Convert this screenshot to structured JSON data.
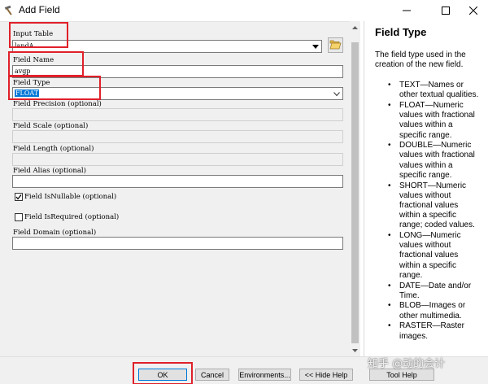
{
  "window": {
    "title": "Add Field",
    "controls": [
      "minimize-icon",
      "maximize-icon",
      "close-icon"
    ]
  },
  "form": {
    "input_table": {
      "label": "Input Table",
      "value": "landA"
    },
    "field_name": {
      "label": "Field Name",
      "value": "avgp"
    },
    "field_type": {
      "label": "Field Type",
      "value": "FLOAT"
    },
    "field_precision": {
      "label": "Field Precision (optional)",
      "value": ""
    },
    "field_scale": {
      "label": "Field Scale (optional)",
      "value": ""
    },
    "field_length": {
      "label": "Field Length (optional)",
      "value": ""
    },
    "field_alias": {
      "label": "Field Alias (optional)",
      "value": ""
    },
    "field_is_nullable": {
      "label": "Field IsNullable (optional)",
      "checked": true
    },
    "field_is_required": {
      "label": "Field IsRequired (optional)",
      "checked": false
    },
    "field_domain": {
      "label": "Field Domain (optional)",
      "value": ""
    }
  },
  "help": {
    "title": "Field Type",
    "intro": "The field type used in the creation of the new field.",
    "items": [
      "TEXT—Names or other textual qualities.",
      "FLOAT—Numeric values with fractional values within a specific range.",
      "DOUBLE—Numeric values with fractional values within a specific range.",
      "SHORT—Numeric values without fractional values within a specific range; coded values.",
      "LONG—Numeric values without fractional values within a specific range.",
      "DATE—Date and/or Time.",
      "BLOB—Images or other multimedia.",
      "RASTER—Raster images."
    ]
  },
  "buttons": {
    "ok": "OK",
    "cancel": "Cancel",
    "environments": "Environments...",
    "hide_help": "<< Hide Help",
    "tool_help": "Tool Help"
  },
  "watermark": "知乎 @动的会计",
  "colors": {
    "highlight": "#e0202a",
    "selection": "#0078d7",
    "panel": "#f0f0f0"
  }
}
